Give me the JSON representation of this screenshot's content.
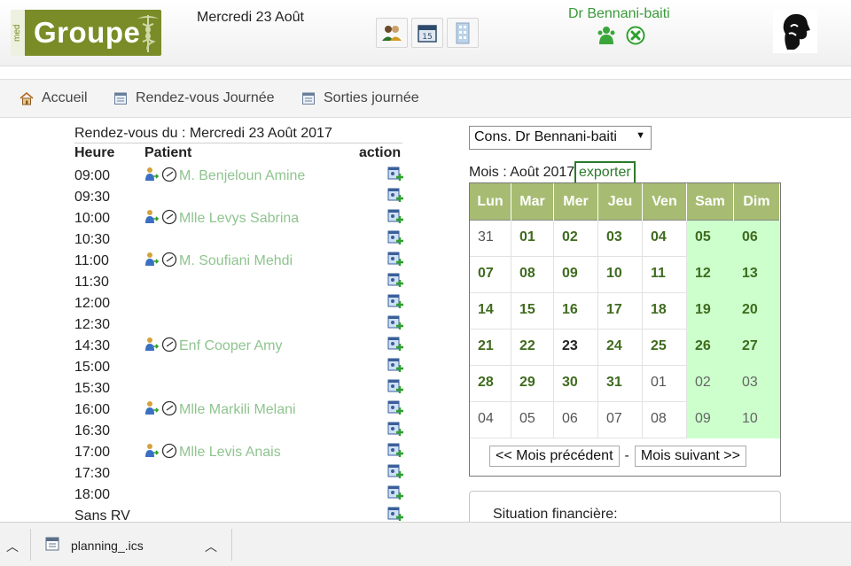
{
  "header": {
    "logo_side_text": "med",
    "logo_text": "Groupe",
    "date": "Mercredi 23 Août",
    "doctor_name": "Dr Bennani-baiti"
  },
  "nav": {
    "items": [
      {
        "label": "Accueil",
        "icon": "home-icon"
      },
      {
        "label": "Rendez-vous Journée",
        "icon": "calendar-doc-icon"
      },
      {
        "label": "Sorties journée",
        "icon": "calendar-doc-icon"
      }
    ]
  },
  "schedule": {
    "title": "Rendez-vous du : Mercredi 23 Août 2017",
    "col_heure": "Heure",
    "col_patient": "Patient",
    "col_action": "action",
    "slots": [
      {
        "time": "09:00",
        "patient": "M. Benjeloun Amine"
      },
      {
        "time": "09:30",
        "patient": ""
      },
      {
        "time": "10:00",
        "patient": "Mlle Levys Sabrina"
      },
      {
        "time": "10:30",
        "patient": ""
      },
      {
        "time": "11:00",
        "patient": "M. Soufiani Mehdi"
      },
      {
        "time": "11:30",
        "patient": ""
      },
      {
        "time": "12:00",
        "patient": ""
      },
      {
        "time": "12:30",
        "patient": ""
      },
      {
        "time": "14:30",
        "patient": "Enf Cooper Amy"
      },
      {
        "time": "15:00",
        "patient": ""
      },
      {
        "time": "15:30",
        "patient": ""
      },
      {
        "time": "16:00",
        "patient": "Mlle Markili Melani"
      },
      {
        "time": "16:30",
        "patient": ""
      },
      {
        "time": "17:00",
        "patient": "Mlle Levis Anais"
      },
      {
        "time": "17:30",
        "patient": ""
      },
      {
        "time": "18:00",
        "patient": ""
      },
      {
        "time": "Sans RV",
        "patient": ""
      }
    ]
  },
  "right": {
    "selected_doctor": "Cons. Dr Bennani-baiti",
    "month_label": "Mois : Août 2017",
    "export_label": "exporter",
    "fin_title": "Situation financière:"
  },
  "calendar": {
    "days": [
      "Lun",
      "Mar",
      "Mer",
      "Jeu",
      "Ven",
      "Sam",
      "Dim"
    ],
    "weeks": [
      [
        {
          "d": "31",
          "s": "n"
        },
        {
          "d": "01",
          "s": "b"
        },
        {
          "d": "02",
          "s": "b"
        },
        {
          "d": "03",
          "s": "b"
        },
        {
          "d": "04",
          "s": "b"
        },
        {
          "d": "05",
          "s": "b"
        },
        {
          "d": "06",
          "s": "b"
        }
      ],
      [
        {
          "d": "07",
          "s": "b"
        },
        {
          "d": "08",
          "s": "b"
        },
        {
          "d": "09",
          "s": "b"
        },
        {
          "d": "10",
          "s": "b"
        },
        {
          "d": "11",
          "s": "b"
        },
        {
          "d": "12",
          "s": "b"
        },
        {
          "d": "13",
          "s": "b"
        }
      ],
      [
        {
          "d": "14",
          "s": "b"
        },
        {
          "d": "15",
          "s": "b"
        },
        {
          "d": "16",
          "s": "b"
        },
        {
          "d": "17",
          "s": "b"
        },
        {
          "d": "18",
          "s": "b"
        },
        {
          "d": "19",
          "s": "b"
        },
        {
          "d": "20",
          "s": "b"
        }
      ],
      [
        {
          "d": "21",
          "s": "b"
        },
        {
          "d": "22",
          "s": "b"
        },
        {
          "d": "23",
          "s": "today"
        },
        {
          "d": "24",
          "s": "b"
        },
        {
          "d": "25",
          "s": "b"
        },
        {
          "d": "26",
          "s": "b"
        },
        {
          "d": "27",
          "s": "b"
        }
      ],
      [
        {
          "d": "28",
          "s": "b"
        },
        {
          "d": "29",
          "s": "b"
        },
        {
          "d": "30",
          "s": "b"
        },
        {
          "d": "31",
          "s": "b"
        },
        {
          "d": "01",
          "s": "n"
        },
        {
          "d": "02",
          "s": "n"
        },
        {
          "d": "03",
          "s": "n"
        }
      ],
      [
        {
          "d": "04",
          "s": "n"
        },
        {
          "d": "05",
          "s": "n"
        },
        {
          "d": "06",
          "s": "n"
        },
        {
          "d": "07",
          "s": "n"
        },
        {
          "d": "08",
          "s": "n"
        },
        {
          "d": "09",
          "s": "n"
        },
        {
          "d": "10",
          "s": "n"
        }
      ]
    ],
    "prev_label": "<< Mois précédent",
    "separator": "-",
    "next_label": "Mois suivant >>"
  },
  "download_bar": {
    "file_name": "planning_.ics"
  },
  "colors": {
    "brand_green": "#7a8c27",
    "calendar_header": "#a7bc72",
    "weekend_bg": "#ccffcc",
    "patient_link": "#8fc48f",
    "doctor_name": "#3a9a3a"
  }
}
